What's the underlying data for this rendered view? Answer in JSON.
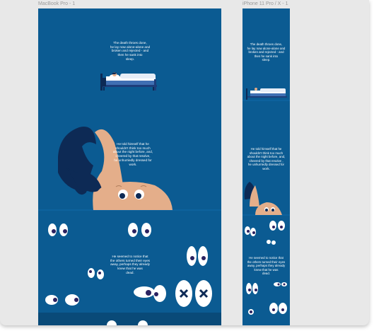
{
  "frames": {
    "mac": {
      "label": "MacBook Pro - 1"
    },
    "phone": {
      "label": "iPhone 11 Pro / X - 1"
    }
  },
  "story": {
    "p1": "The death throes done,\nhe lay now alone-alone and\nbroken and rejected - and\nthen he sank into\nsleep.",
    "p2": "He told himself that he\nshouldn't think too much\nabout the night before, and,\ncheered by that resolve,\nhe unhurriedly dressed for\nwork.",
    "p2_phone": "He told himself that he\nshouldn't think too much\nabout the night before, and,\ncheered by that resolve ,\nhe unhurriedly dressed for\nwork.",
    "p3": "He seemed to notice that\nthe others turned their eyes\naway, perhaps they already\nknew that he was\ndead.",
    "p3_phone": "He seemed to notice that\nthe others turned their eyes\naway, perhaps they already\nknew that he was\ndead."
  },
  "colors": {
    "background": "#0b5b92",
    "dark_band": "#094a78",
    "skin": "#e4ae8a",
    "hair": "#0d2a55",
    "pillow": "#ffffff",
    "bed": "#3f6fb3"
  }
}
